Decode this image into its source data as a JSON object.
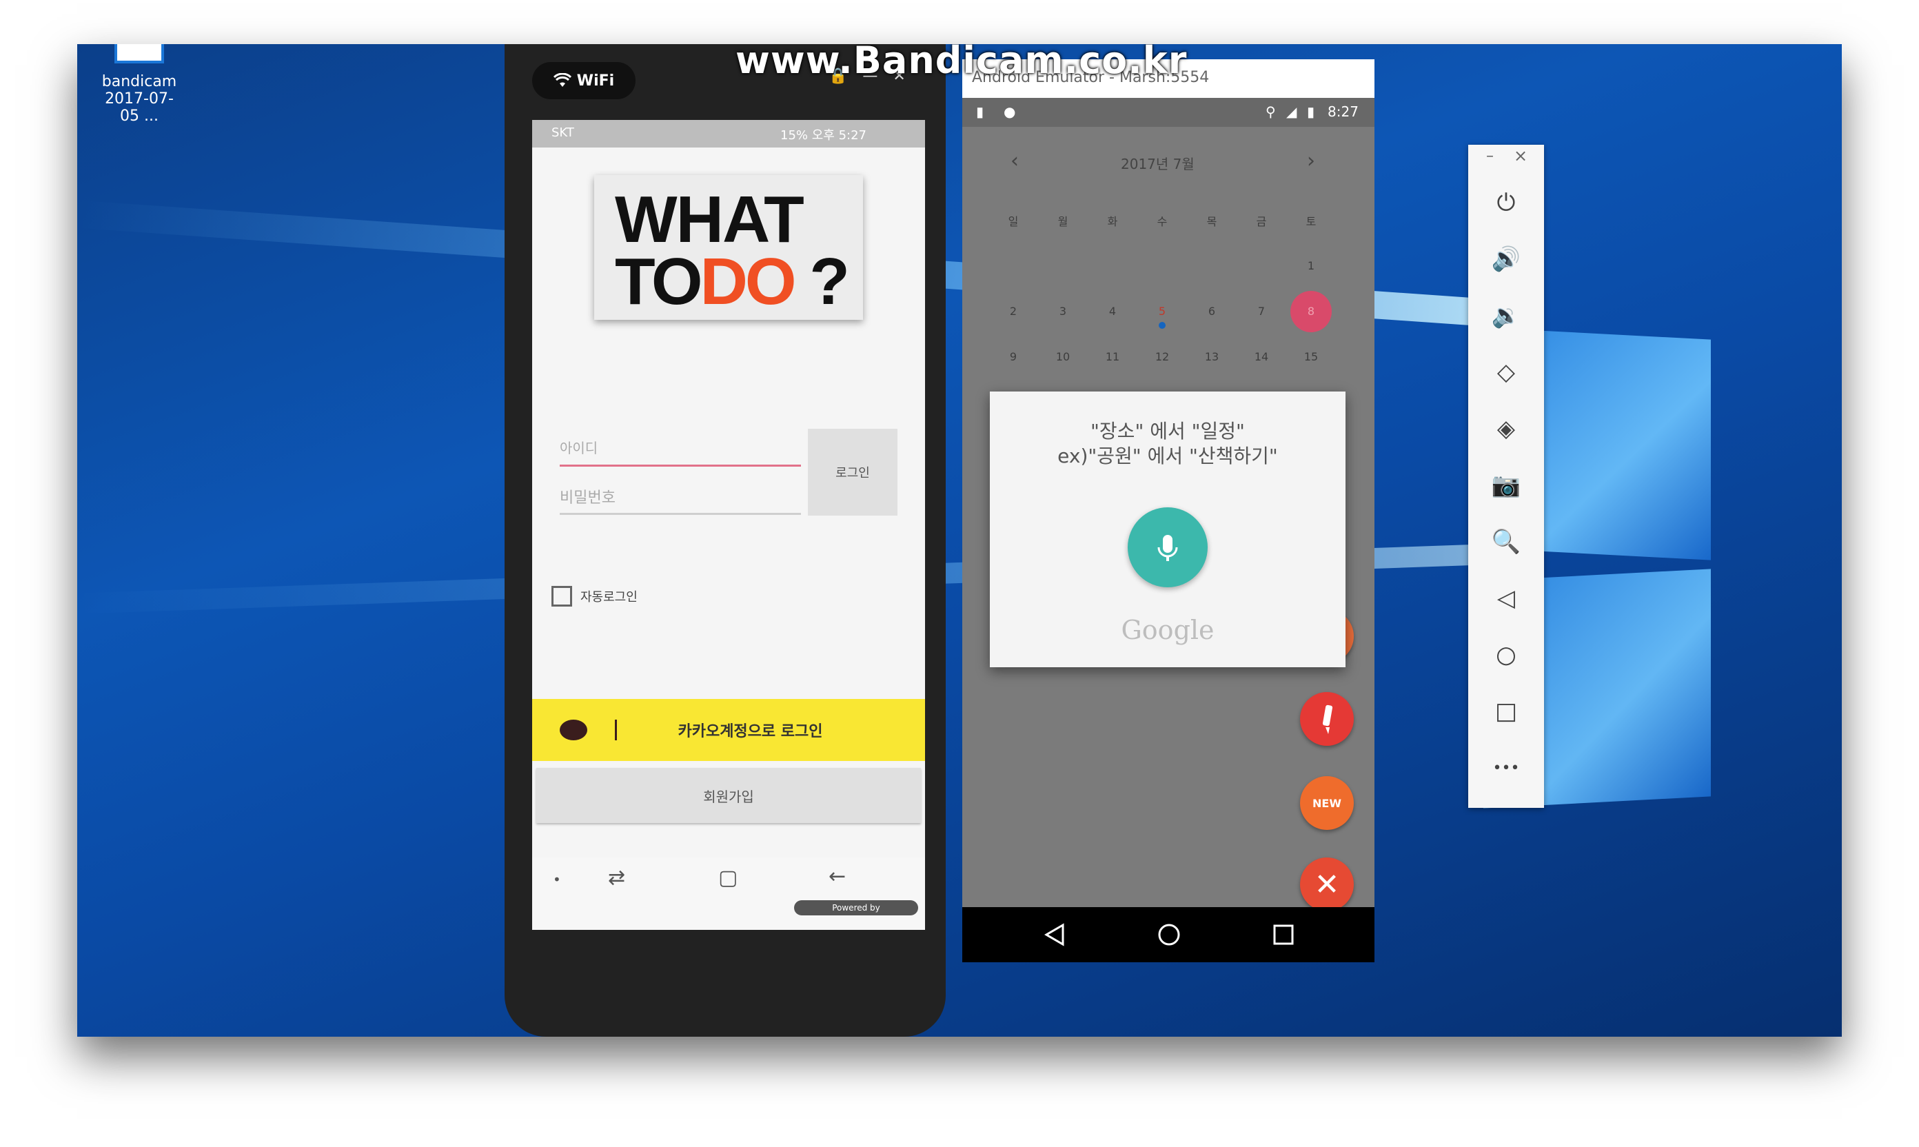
{
  "desktop": {
    "icon_label": "bandicam",
    "icon_sublabel": "2017-07-05 ..."
  },
  "watermark": "www.Bandicam.co.kr",
  "phone": {
    "wifi_label": "WiFi",
    "window_controls": {
      "lock": "🔒",
      "minimize": "—",
      "close": "✕"
    },
    "status": {
      "carrier": "SKT",
      "right": "15% 오후 5:27"
    },
    "logo": {
      "line1": "WHAT",
      "line2_a": "TO",
      "line2_b": "DO",
      "line2_c": " ?"
    },
    "id_placeholder": "아이디",
    "password_placeholder": "비밀번호",
    "login_button": "로그인",
    "auto_login_label": "자동로그인",
    "kakao_login": "카카오계정으로 로그인",
    "signup_button": "회원가입",
    "powered_by": "Powered by"
  },
  "emulator": {
    "title": "Android Emulator - Marsh:5554",
    "time": "8:27",
    "calendar": {
      "month": "2017년 7월",
      "weekdays": [
        "일",
        "월",
        "화",
        "수",
        "목",
        "금",
        "토"
      ],
      "week1": [
        "",
        "",
        "",
        "",
        "",
        "",
        "1"
      ],
      "week2": [
        "2",
        "3",
        "4",
        "5",
        "6",
        "7",
        "8"
      ],
      "week3": [
        "9",
        "10",
        "11",
        "12",
        "13",
        "14",
        "15"
      ]
    },
    "dialog": {
      "line1": "\"장소\" 에서 \"일정\"",
      "line2": "ex)\"공원\" 에서 \"산책하기\"",
      "google": "Google"
    },
    "fab_new_label": "NEW"
  },
  "toolbar": {
    "minimize": "–",
    "close": "×",
    "more": "•••"
  },
  "colors": {
    "kakao_yellow": "#f9e733",
    "mic_teal": "#3cb8ac",
    "fab_red": "#e53935",
    "fab_orange": "#ef6c2c",
    "desktop_blue": "#0d56b5"
  }
}
